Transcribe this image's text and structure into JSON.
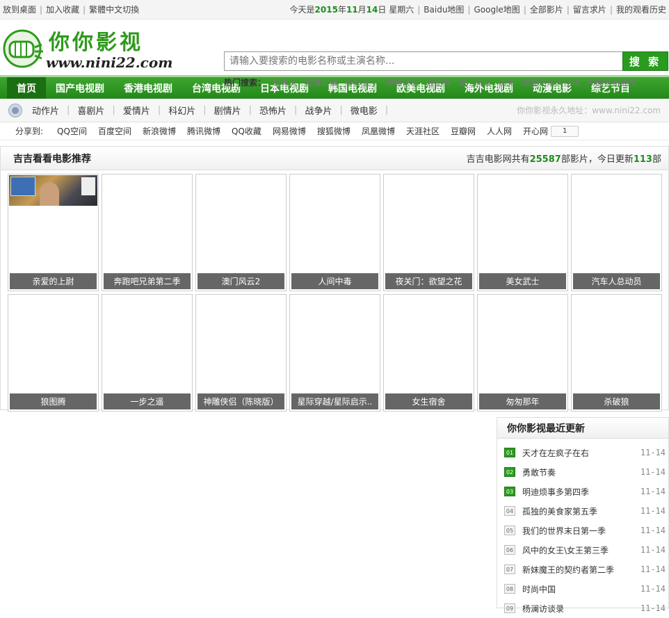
{
  "topbar": {
    "left": [
      "放到桌面",
      "加入收藏",
      "繁體中文切換"
    ],
    "date_prefix": "今天是",
    "year": "2015",
    "year_unit": "年",
    "month": "11",
    "month_unit": "月",
    "day": "14",
    "day_unit": "日",
    "weekday": "星期六",
    "right": [
      "Baidu地图",
      "Google地图",
      "全部影片",
      "留言求片",
      "我的观看历史"
    ]
  },
  "header": {
    "logo_title": "你你影视",
    "logo_url": "www.nini22.com",
    "search_placeholder": "请输入要搜索的电影名称或主演名称...",
    "search_button": "搜 索",
    "hot_label": "热门搜索：",
    "hot_keywords": [
      "包青天",
      "爱情公寓",
      "杉杉来了",
      "神雕侠侣",
      "狼图腾",
      "澳门风云",
      "功夫",
      "微爱之渐入佳境",
      "中国惊奇先生"
    ]
  },
  "nav": [
    "首页",
    "国产电视剧",
    "香港电视剧",
    "台湾电视剧",
    "日本电视剧",
    "韩国电视剧",
    "欧美电视剧",
    "海外电视剧",
    "动漫电影",
    "综艺节目"
  ],
  "subnav": {
    "categories": [
      "动作片",
      "喜剧片",
      "爱情片",
      "科幻片",
      "剧情片",
      "恐怖片",
      "战争片",
      "微电影"
    ],
    "address": "你你影视永久地址：www.nini22.com"
  },
  "share": {
    "label": "分享到:",
    "targets": [
      "QQ空间",
      "百度空间",
      "新浪微博",
      "腾讯微博",
      "QQ收藏",
      "网易微博",
      "搜狐微博",
      "凤凰微博",
      "天涯社区",
      "豆瓣网",
      "人人网",
      "开心网"
    ],
    "count": "1"
  },
  "recommend": {
    "title": "吉吉看看电影推荐",
    "stat_prefix": "吉吉电影网共有",
    "total": "25587",
    "stat_mid": "部影片，今日更新",
    "today": "113",
    "stat_suffix": "部",
    "movies": [
      "亲爱的上尉",
      "奔跑吧兄弟第二季",
      "澳门风云2",
      "人间中毒",
      "夜关门：欲望之花",
      "美女武士",
      "汽车人总动员",
      "狼图腾",
      "一步之遥",
      "神雕侠侣（陈晓版）",
      "星际穿越/星际启示..",
      "女生宿舍",
      "匆匆那年",
      "杀破狼"
    ]
  },
  "updates": {
    "title": "你你影视最近更新",
    "items": [
      {
        "num": "01",
        "title": "天才在左疯子在右",
        "date": "11-14"
      },
      {
        "num": "02",
        "title": "勇敢节奏",
        "date": "11-14"
      },
      {
        "num": "03",
        "title": "明迪烦事多第四季",
        "date": "11-14"
      },
      {
        "num": "04",
        "title": "孤独的美食家第五季",
        "date": "11-14"
      },
      {
        "num": "05",
        "title": "我们的世界末日第一季",
        "date": "11-14"
      },
      {
        "num": "06",
        "title": "风中的女王\\女王第三季",
        "date": "11-14"
      },
      {
        "num": "07",
        "title": "新妹魔王的契约者第二季",
        "date": "11-14"
      },
      {
        "num": "08",
        "title": "时尚中国",
        "date": "11-14"
      },
      {
        "num": "09",
        "title": "杨澜访谈录",
        "date": "11-14"
      }
    ]
  }
}
